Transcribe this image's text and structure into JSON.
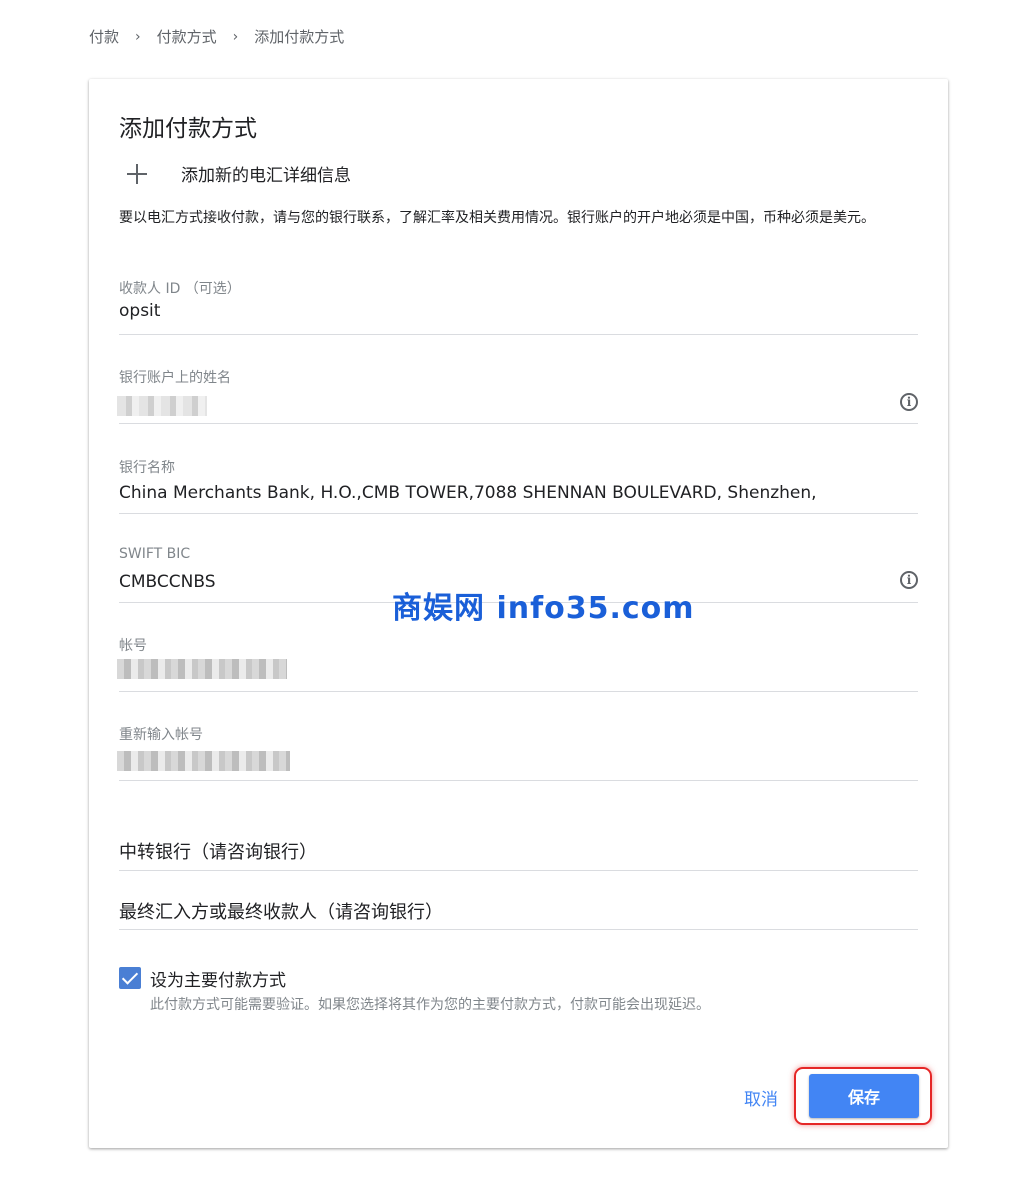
{
  "breadcrumb": {
    "items": [
      "付款",
      "付款方式",
      "添加付款方式"
    ],
    "separator": "›"
  },
  "card": {
    "title": "添加付款方式",
    "add_new_label": "添加新的电汇详细信息",
    "description": "要以电汇方式接收付款，请与您的银行联系，了解汇率及相关费用情况。银行账户的开户地必须是中国，币种必须是美元。"
  },
  "fields": {
    "payee_id": {
      "label": "收款人 ID （可选）",
      "value": "opsit"
    },
    "account_name": {
      "label": "银行账户上的姓名",
      "value": ""
    },
    "bank_name": {
      "label": "银行名称",
      "value": "China Merchants Bank, H.O.,CMB TOWER,7088 SHENNAN BOULEVARD, Shenzhen,"
    },
    "swift_bic": {
      "label": "SWIFT BIC",
      "value": "CMBCCNBS"
    },
    "account_number": {
      "label": "帐号",
      "value": ""
    },
    "account_number_confirm": {
      "label": "重新输入帐号",
      "value": ""
    },
    "intermediary_bank": {
      "placeholder": "中转银行（请咨询银行）"
    },
    "final_beneficiary": {
      "placeholder": "最终汇入方或最终收款人（请咨询银行）"
    }
  },
  "primary": {
    "label": "设为主要付款方式",
    "help": "此付款方式可能需要验证。如果您选择将其作为您的主要付款方式，付款可能会出现延迟。",
    "checked": true
  },
  "actions": {
    "cancel": "取消",
    "save": "保存"
  },
  "watermark": "商娱网 info35.com",
  "colors": {
    "accent": "#4285f4",
    "highlight": "#e52727",
    "watermark": "#1a5fd8"
  },
  "icons": [
    "plus-icon",
    "info-icon",
    "checkbox-check-icon"
  ]
}
